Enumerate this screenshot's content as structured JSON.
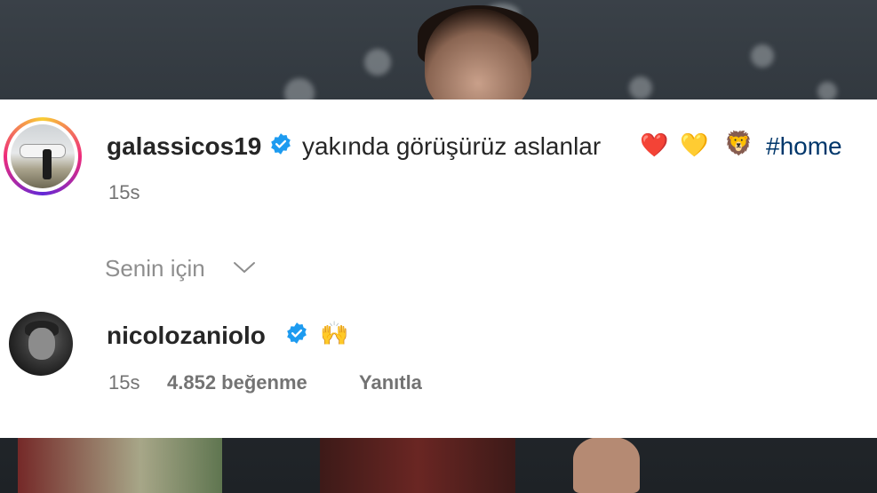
{
  "comments": [
    {
      "username": "galassicos19",
      "verified": true,
      "text": "yakında görüşürüz aslanlar",
      "emojis": [
        "❤️",
        "💛",
        "🦁"
      ],
      "hashtag": "#home",
      "time": "15s"
    },
    {
      "username": "nicolozaniolo",
      "verified": true,
      "emoji": "🙌",
      "time": "15s",
      "likes": "4.852 beğenme",
      "reply_label": "Yanıtla"
    }
  ],
  "section_label": "Senin için",
  "icons": {
    "verified": "verified-badge-icon",
    "dropdown": "chevron-down-icon"
  },
  "colors": {
    "verified": "#1d9bf0",
    "username": "#262626",
    "meta": "#737373",
    "hashtag": "#00376b"
  }
}
